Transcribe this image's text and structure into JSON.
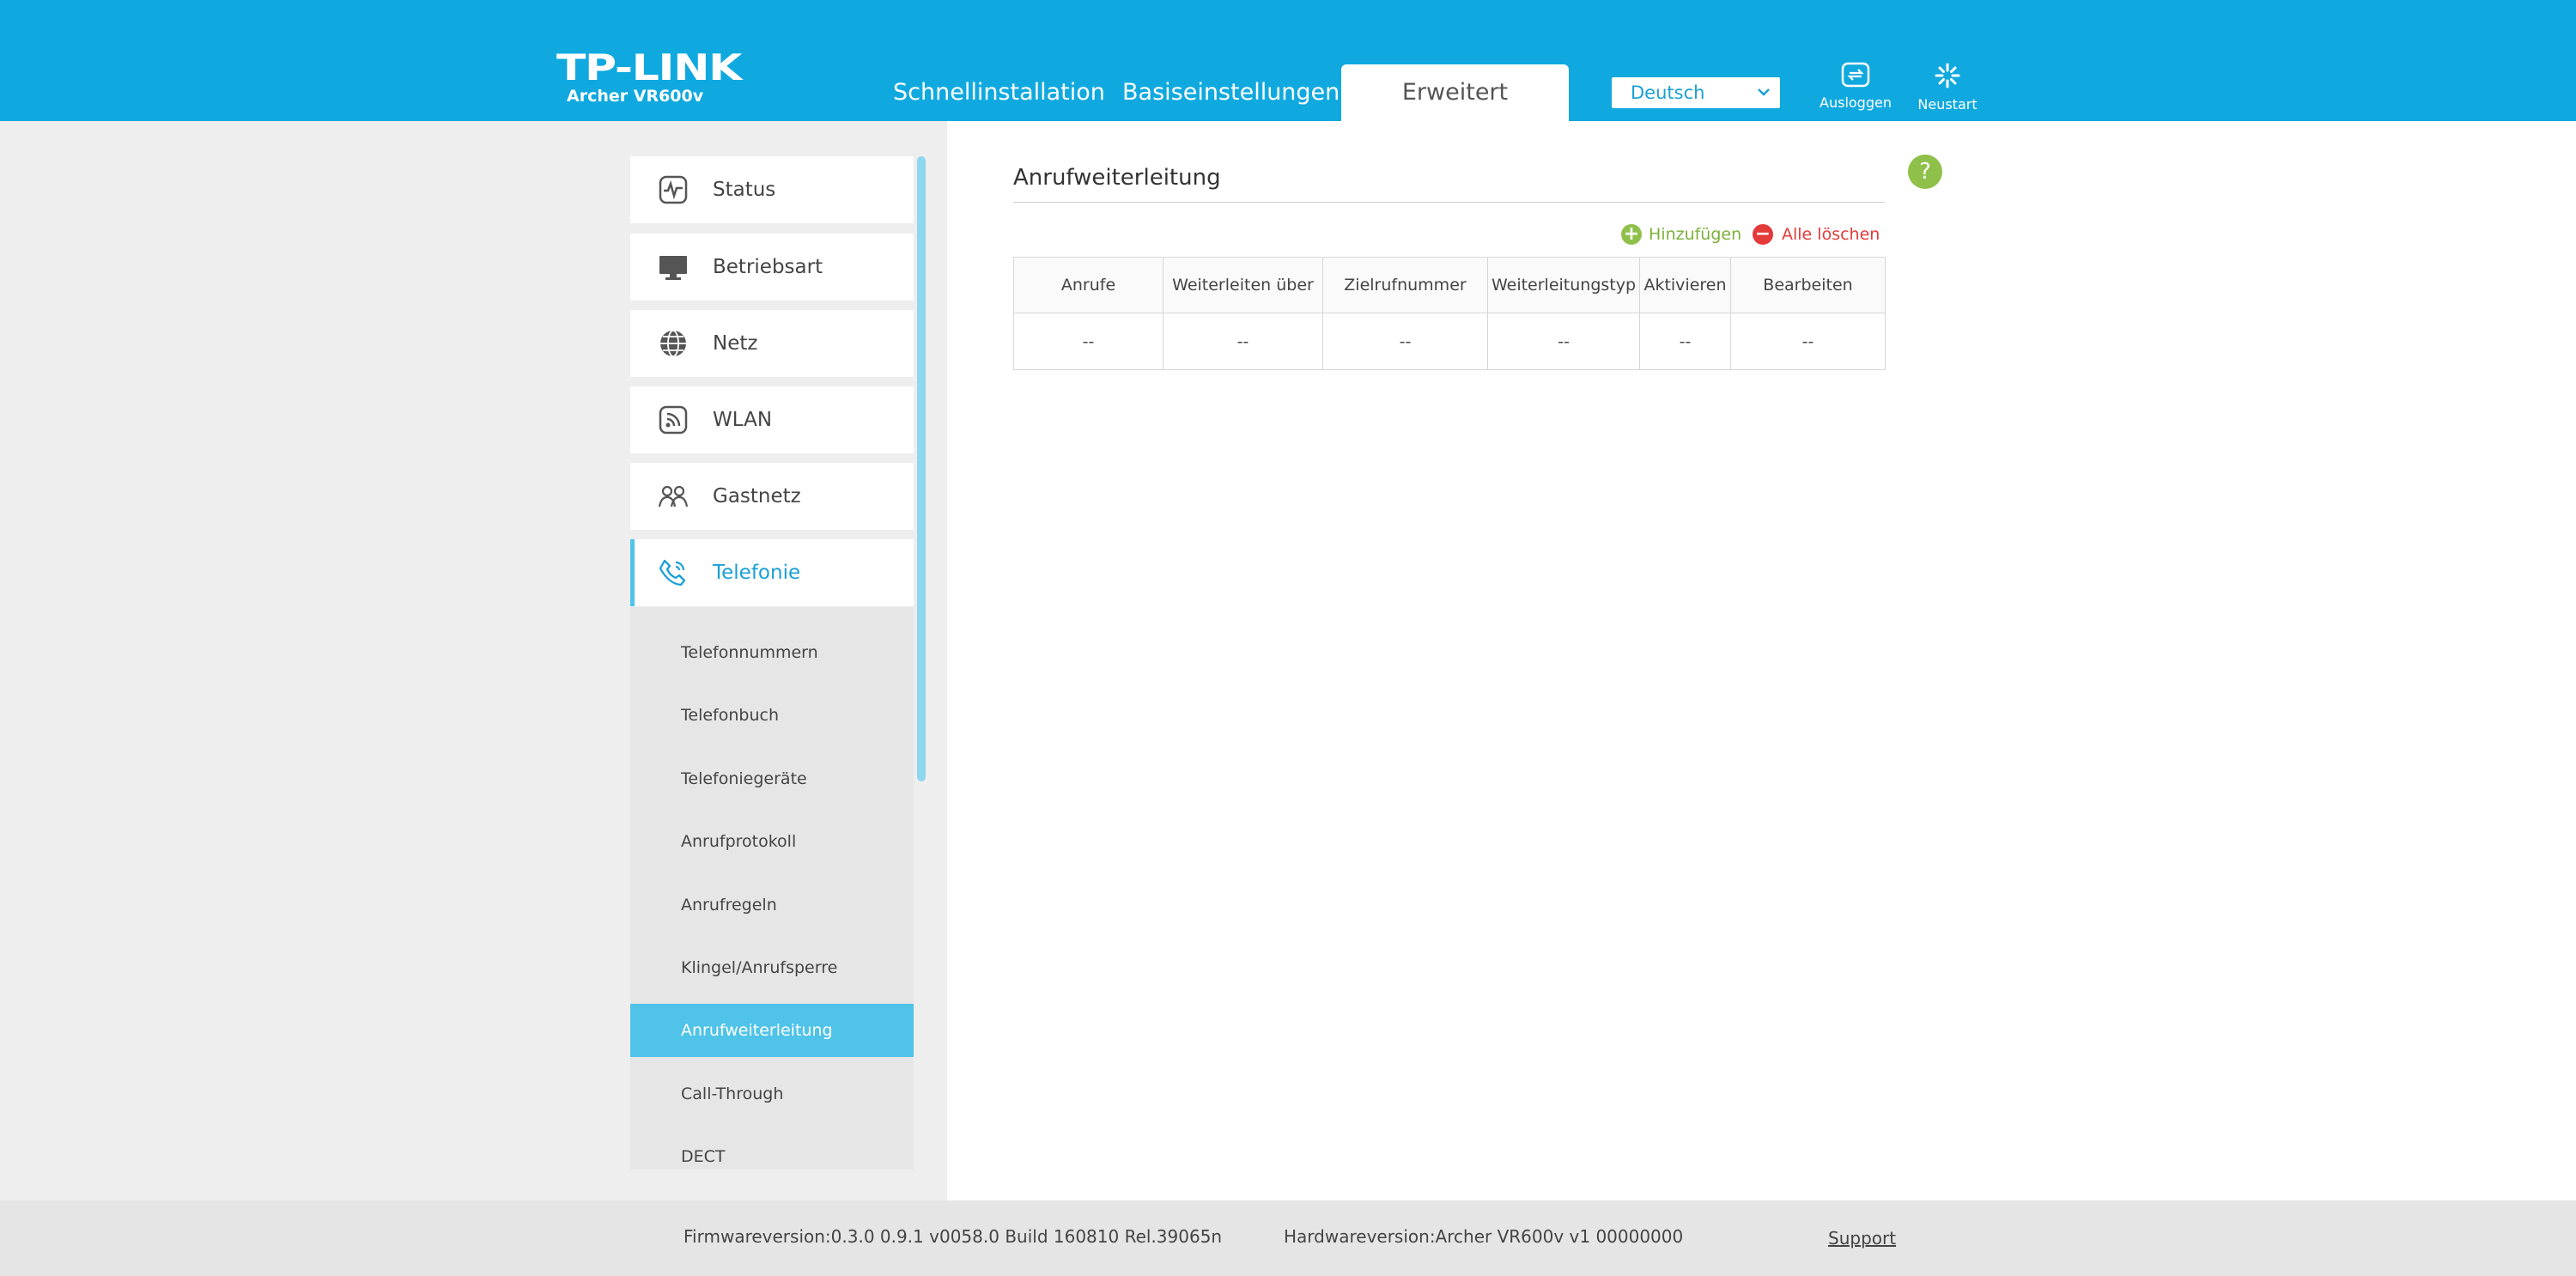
{
  "header": {
    "logo": "TP-LINK",
    "model": "Archer VR600v",
    "tabs": [
      {
        "label": "Schnellinstallation"
      },
      {
        "label": "Basiseinstellungen"
      },
      {
        "label": "Erweitert"
      }
    ],
    "active_tab": "Erweitert",
    "language": "Deutsch",
    "logout_label": "Ausloggen",
    "reboot_label": "Neustart"
  },
  "colors": {
    "header_bg": "#10a9df",
    "accent": "#4fc3e8",
    "add_green": "#8fc04a",
    "delete_red": "#e53a3a"
  },
  "sidebar": {
    "items": [
      {
        "label": "Status",
        "icon": "status-pulse-icon"
      },
      {
        "label": "Betriebsart",
        "icon": "monitor-icon"
      },
      {
        "label": "Netz",
        "icon": "globe-icon"
      },
      {
        "label": "WLAN",
        "icon": "wifi-icon"
      },
      {
        "label": "Gastnetz",
        "icon": "guest-users-icon"
      },
      {
        "label": "Telefonie",
        "icon": "phone-icon",
        "active": true
      }
    ],
    "subitems": [
      {
        "label": "Telefonnummern"
      },
      {
        "label": "Telefonbuch"
      },
      {
        "label": "Telefoniegeräte"
      },
      {
        "label": "Anrufprotokoll"
      },
      {
        "label": "Anrufregeln"
      },
      {
        "label": "Klingel/Anrufsperre"
      },
      {
        "label": "Anrufweiterleitung",
        "active": true
      },
      {
        "label": "Call-Through"
      },
      {
        "label": "DECT"
      }
    ]
  },
  "main": {
    "title": "Anrufweiterleitung",
    "help_label": "?",
    "add_label": "Hinzufügen",
    "delete_all_label": "Alle löschen",
    "table": {
      "headers": [
        "Anrufe",
        "Weiterleiten über",
        "Zielrufnummer",
        "Weiterleitungstyp",
        "Aktivieren",
        "Bearbeiten"
      ],
      "rows": [
        [
          "--",
          "--",
          "--",
          "--",
          "--",
          "--"
        ]
      ]
    }
  },
  "footer": {
    "firmware": "Firmwareversion:0.3.0 0.9.1 v0058.0 Build 160810 Rel.39065n",
    "hardware": "Hardwareversion:Archer VR600v v1 00000000",
    "support": "Support"
  }
}
